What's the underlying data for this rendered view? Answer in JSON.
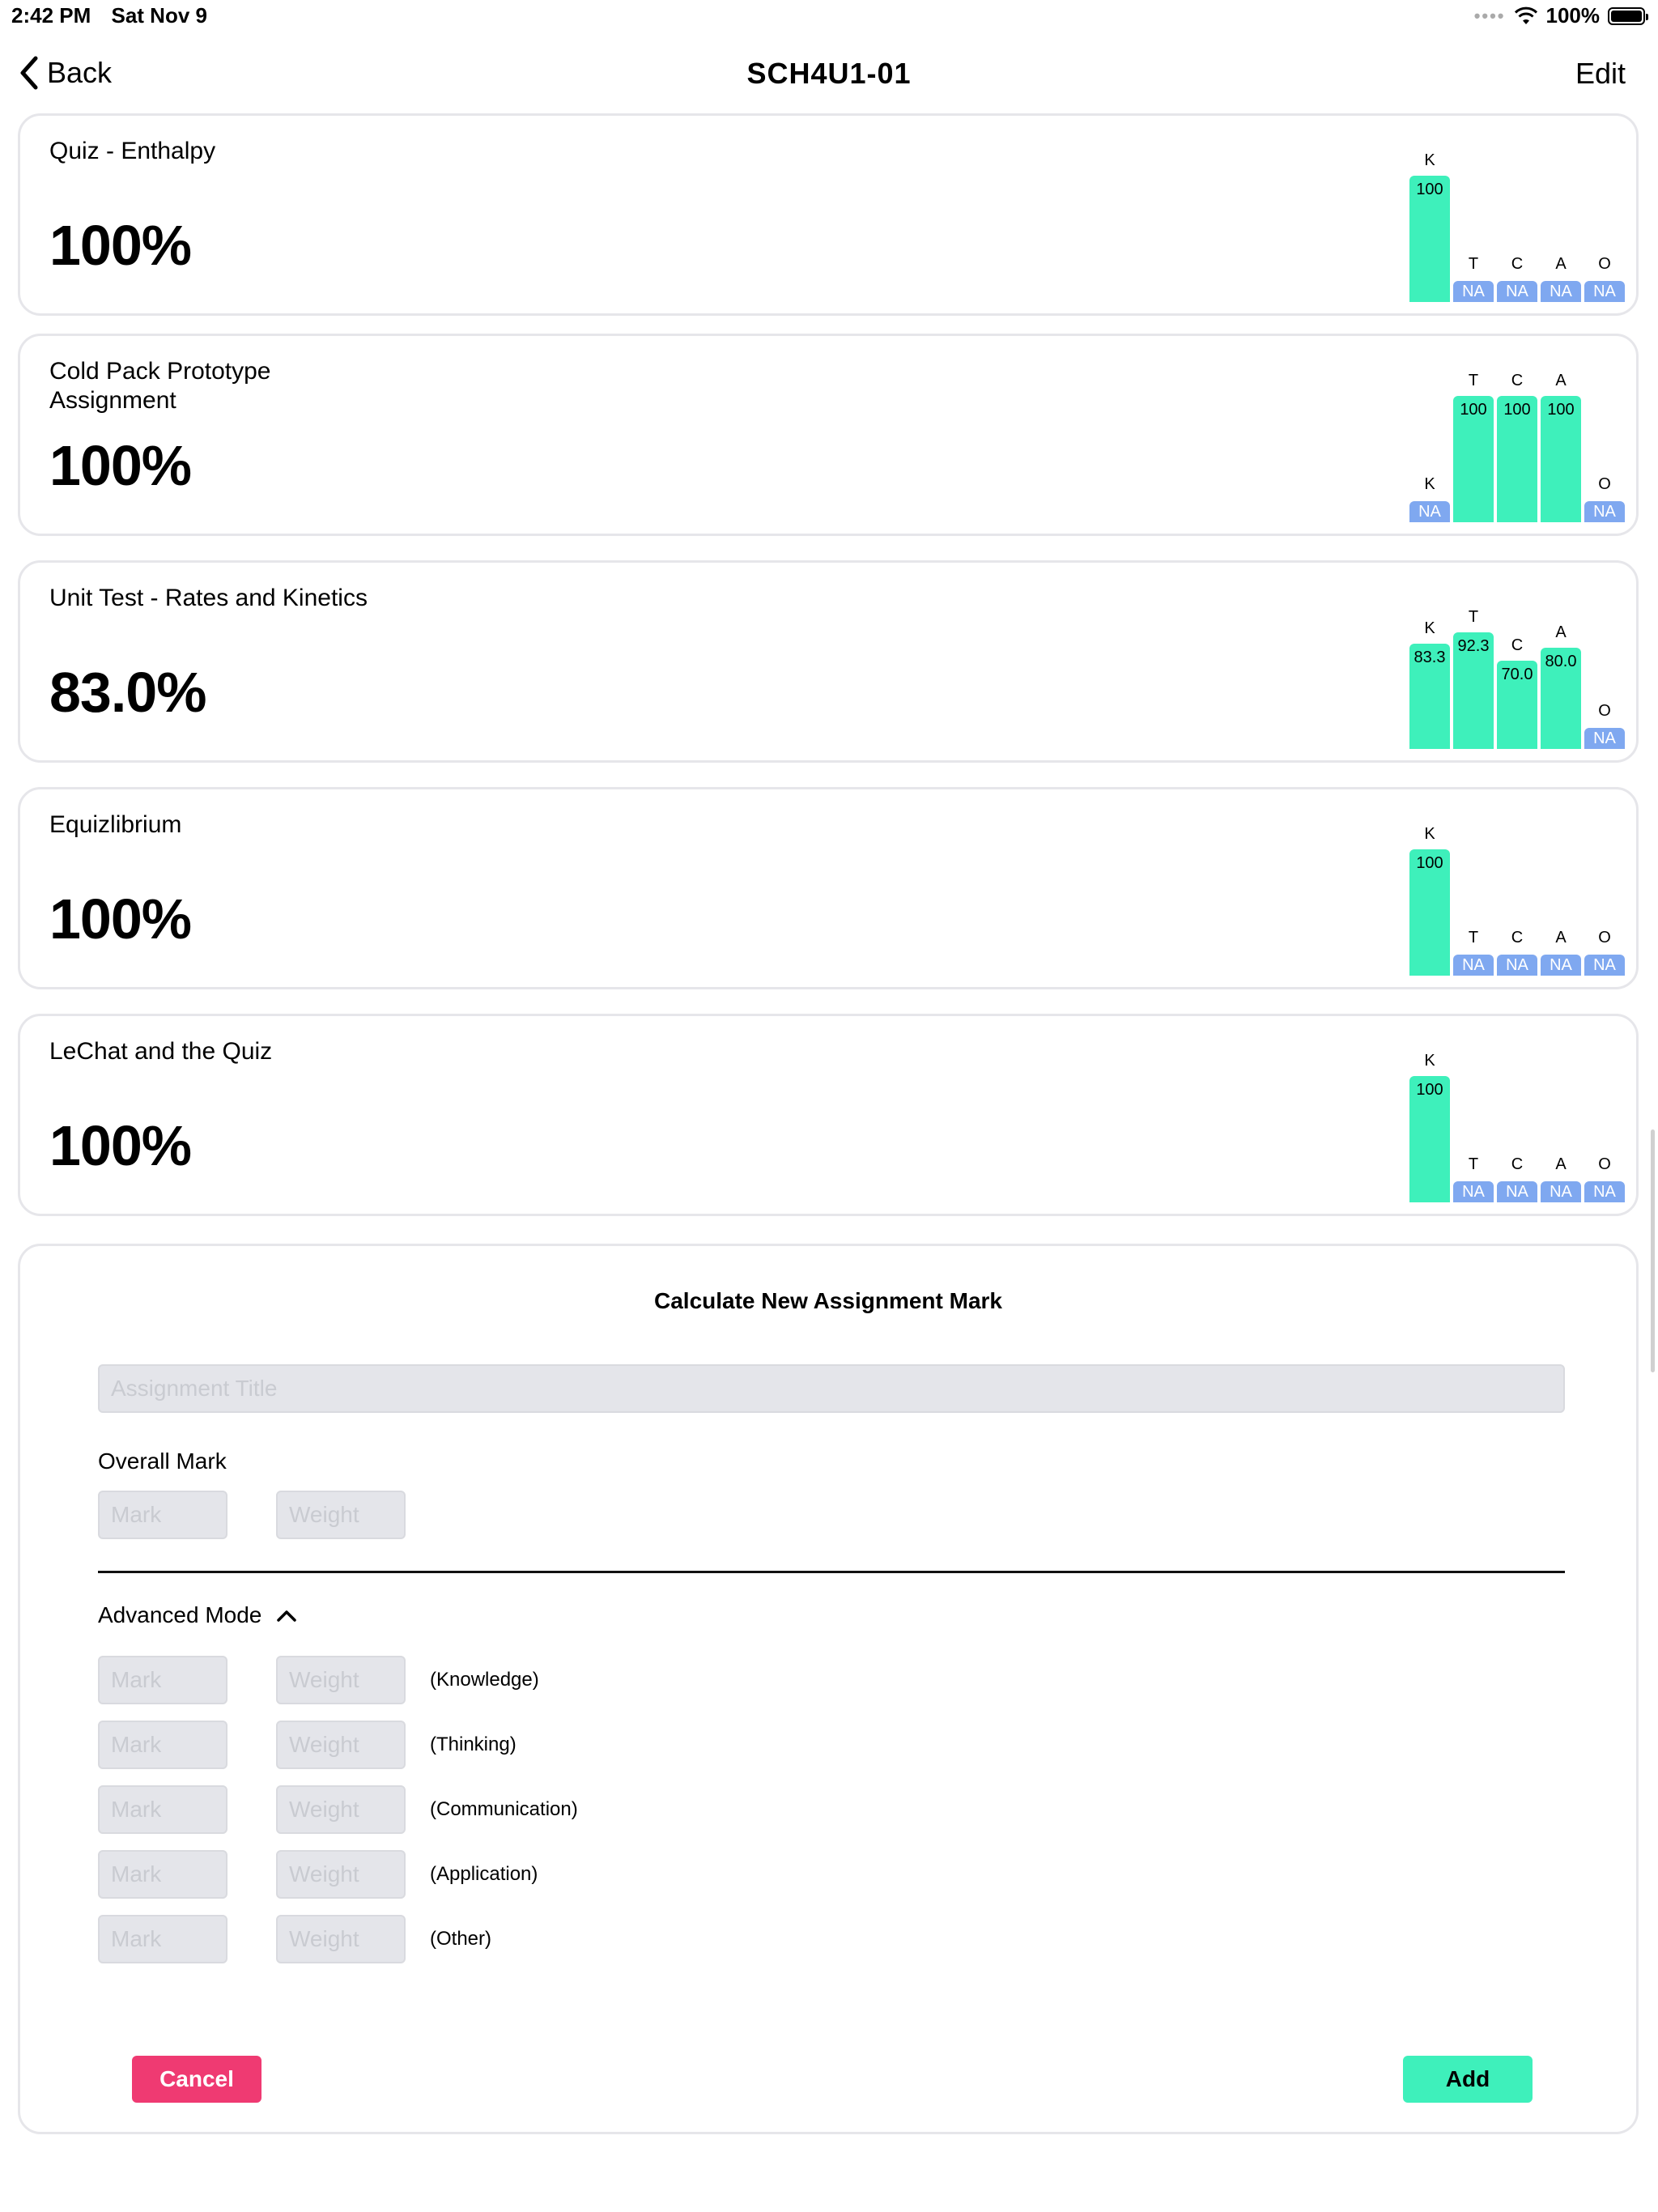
{
  "status_bar": {
    "time": "2:42 PM",
    "date": "Sat Nov 9",
    "battery": "100%"
  },
  "nav": {
    "back_label": "Back",
    "title": "SCH4U1-01",
    "edit_label": "Edit"
  },
  "colors": {
    "bar": "#3ef0bb",
    "na": "#7fa8f0",
    "cancel": "#ef3a72",
    "add": "#3ef0bb"
  },
  "assignments": [
    {
      "title": "Quiz - Enthalpy",
      "mark": "100%",
      "bars": [
        {
          "letter": "K",
          "value": 100,
          "label": "100"
        },
        {
          "letter": "T",
          "value": null,
          "label": "NA"
        },
        {
          "letter": "C",
          "value": null,
          "label": "NA"
        },
        {
          "letter": "A",
          "value": null,
          "label": "NA"
        },
        {
          "letter": "O",
          "value": null,
          "label": "NA"
        }
      ]
    },
    {
      "title": "Cold Pack Prototype Assignment",
      "mark": "100%",
      "bars": [
        {
          "letter": "K",
          "value": null,
          "label": "NA"
        },
        {
          "letter": "T",
          "value": 100,
          "label": "100"
        },
        {
          "letter": "C",
          "value": 100,
          "label": "100"
        },
        {
          "letter": "A",
          "value": 100,
          "label": "100"
        },
        {
          "letter": "O",
          "value": null,
          "label": "NA"
        }
      ]
    },
    {
      "title": "Unit Test - Rates and Kinetics",
      "mark": "83.0%",
      "bars": [
        {
          "letter": "K",
          "value": 83.3,
          "label": "83.3"
        },
        {
          "letter": "T",
          "value": 92.3,
          "label": "92.3"
        },
        {
          "letter": "C",
          "value": 70.0,
          "label": "70.0"
        },
        {
          "letter": "A",
          "value": 80.0,
          "label": "80.0"
        },
        {
          "letter": "O",
          "value": null,
          "label": "NA"
        }
      ]
    },
    {
      "title": "Equizlibrium",
      "mark": "100%",
      "bars": [
        {
          "letter": "K",
          "value": 100,
          "label": "100"
        },
        {
          "letter": "T",
          "value": null,
          "label": "NA"
        },
        {
          "letter": "C",
          "value": null,
          "label": "NA"
        },
        {
          "letter": "A",
          "value": null,
          "label": "NA"
        },
        {
          "letter": "O",
          "value": null,
          "label": "NA"
        }
      ]
    },
    {
      "title": "LeChat and the Quiz",
      "mark": "100%",
      "bars": [
        {
          "letter": "K",
          "value": 100,
          "label": "100"
        },
        {
          "letter": "T",
          "value": null,
          "label": "NA"
        },
        {
          "letter": "C",
          "value": null,
          "label": "NA"
        },
        {
          "letter": "A",
          "value": null,
          "label": "NA"
        },
        {
          "letter": "O",
          "value": null,
          "label": "NA"
        }
      ]
    }
  ],
  "calculator": {
    "title": "Calculate New Assignment Mark",
    "title_placeholder": "Assignment Title",
    "overall_label": "Overall Mark",
    "mark_placeholder": "Mark",
    "weight_placeholder": "Weight",
    "advanced_label": "Advanced Mode",
    "categories": [
      "(Knowledge)",
      "(Thinking)",
      "(Communication)",
      "(Application)",
      "(Other)"
    ],
    "cancel_label": "Cancel",
    "add_label": "Add"
  }
}
